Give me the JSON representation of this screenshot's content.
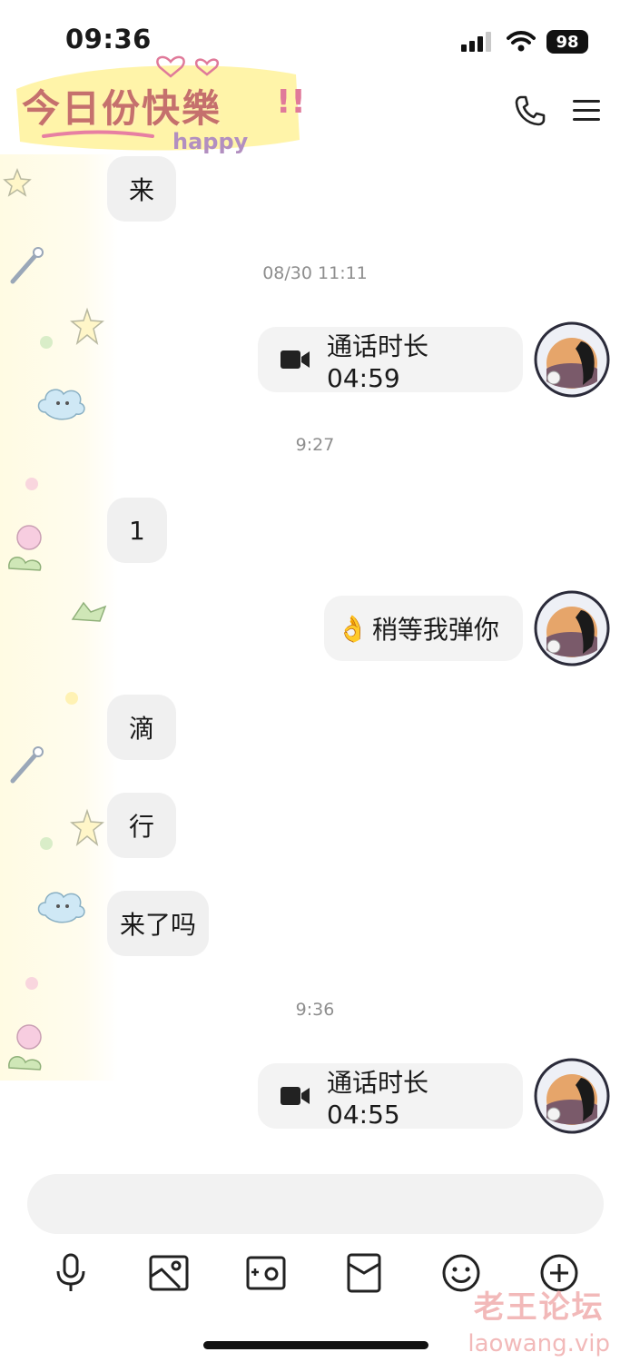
{
  "status": {
    "time": "09:36",
    "battery": "98"
  },
  "header": {
    "title": "今日份快樂",
    "title_sub": "happy",
    "title_mark": "!!"
  },
  "messages": [
    {
      "type": "incoming",
      "text": "来"
    },
    {
      "type": "timestamp",
      "text": "08/30 11:11"
    },
    {
      "type": "outgoing-call",
      "text": "通话时长 04:59"
    },
    {
      "type": "timestamp",
      "text": "9:27"
    },
    {
      "type": "incoming",
      "text": "1"
    },
    {
      "type": "outgoing",
      "emoji": "👌",
      "text": "稍等我弹你"
    },
    {
      "type": "incoming",
      "text": "滴"
    },
    {
      "type": "incoming",
      "text": "行"
    },
    {
      "type": "incoming",
      "text": "来了吗"
    },
    {
      "type": "timestamp",
      "text": "9:36"
    },
    {
      "type": "outgoing-call",
      "text": "通话时长 04:55"
    }
  ],
  "input": {
    "placeholder": ""
  },
  "toolbar": [
    "microphone-icon",
    "image-icon",
    "camera-icon",
    "red-packet-icon",
    "emoji-icon",
    "plus-icon"
  ],
  "watermark": {
    "main": "老王论坛",
    "sub": "laowang.vip"
  },
  "colors": {
    "bubble": "#f0f0f0",
    "title": "#c5706d",
    "watermark": "#f2b9b9"
  }
}
